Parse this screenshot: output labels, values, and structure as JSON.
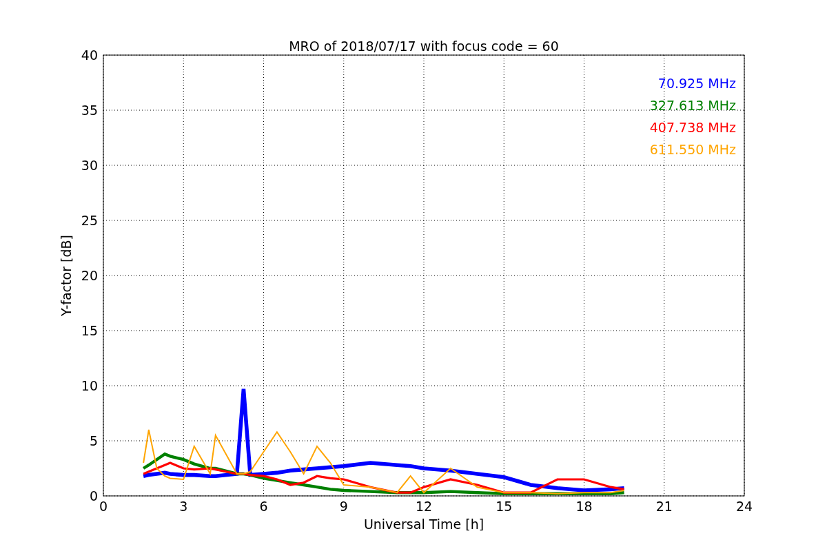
{
  "chart_data": {
    "type": "line",
    "title": "MRO of 2018/07/17 with focus code = 60",
    "xlabel": "Universal Time [h]",
    "ylabel": "Y-factor [dB]",
    "x": [
      1.5,
      1.7,
      2,
      2.3,
      2.5,
      3,
      3.4,
      4,
      4.2,
      5,
      5.25,
      5.5,
      6,
      6.5,
      7,
      7.5,
      8,
      8.5,
      9,
      10,
      11,
      11.5,
      12,
      13,
      14,
      15,
      16,
      17,
      18,
      19,
      19.5
    ],
    "series": [
      {
        "name": "70.925 MHz",
        "color": "#0000ff",
        "values": [
          1.8,
          1.9,
          2,
          2.1,
          2,
          1.9,
          1.9,
          1.8,
          1.8,
          2,
          9.7,
          1.9,
          2,
          2.1,
          2.3,
          2.4,
          2.5,
          2.6,
          2.7,
          3,
          2.8,
          2.7,
          2.5,
          2.3,
          2,
          1.7,
          1,
          0.7,
          0.5,
          0.6,
          0.7
        ]
      },
      {
        "name": "327.613 MHz",
        "color": "#008000",
        "values": [
          2.5,
          2.8,
          3.3,
          3.8,
          3.6,
          3.3,
          2.9,
          2.5,
          2.5,
          2,
          2,
          1.9,
          1.6,
          1.4,
          1.2,
          1,
          0.8,
          0.6,
          0.5,
          0.4,
          0.3,
          0.3,
          0.3,
          0.4,
          0.3,
          0.2,
          0.2,
          0.2,
          0.2,
          0.2,
          0.3
        ]
      },
      {
        "name": "407.738 MHz",
        "color": "#ff0000",
        "values": [
          2,
          2.2,
          2.5,
          2.8,
          3,
          2.5,
          2.4,
          2.5,
          2.4,
          2,
          2,
          1.9,
          1.8,
          1.5,
          1,
          1.2,
          1.8,
          1.6,
          1.5,
          0.8,
          0.3,
          0.3,
          0.8,
          1.5,
          1,
          0.3,
          0.3,
          1.5,
          1.5,
          0.8,
          0.6
        ]
      },
      {
        "name": "611.550 MHz",
        "color": "#ffa500",
        "values": [
          3,
          6,
          2.5,
          1.8,
          1.6,
          1.5,
          4.5,
          2,
          5.5,
          2,
          2,
          2.2,
          4,
          5.8,
          4,
          2,
          4.5,
          3,
          1,
          0.8,
          0.3,
          1.8,
          0.3,
          2.5,
          0.8,
          0.3,
          0.3,
          0.2,
          0.3,
          0.3,
          0.5
        ]
      }
    ],
    "xlim": [
      0,
      24
    ],
    "ylim": [
      0,
      40
    ],
    "xticks": [
      0,
      3,
      6,
      9,
      12,
      15,
      18,
      21,
      24
    ],
    "yticks": [
      0,
      5,
      10,
      15,
      20,
      25,
      30,
      35,
      40
    ],
    "grid": true
  }
}
